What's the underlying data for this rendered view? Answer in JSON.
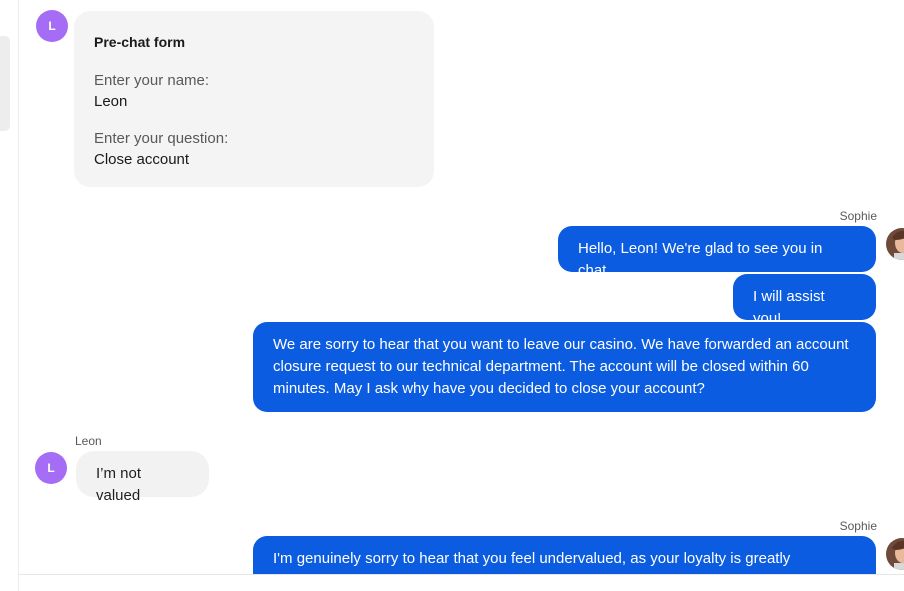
{
  "prechat_form": {
    "avatar_letter": "L",
    "title": "Pre-chat form",
    "fields": [
      {
        "label": "Enter your name:",
        "value": "Leon"
      },
      {
        "label": "Enter your question:",
        "value": "Close account"
      }
    ]
  },
  "messages": [
    {
      "sender": "Sophie",
      "text": "Hello, Leon! We're glad to see you in chat."
    },
    {
      "text": "I will assist you!"
    },
    {
      "text": "We are sorry to hear that you want to leave our casino. We have forwarded an account closure request to our technical department. The account will be closed within 60 minutes. May I ask why have you decided to close your account?"
    },
    {
      "sender": "Leon",
      "avatar_letter": "L",
      "text": "I’m not valued"
    },
    {
      "sender": "Sophie",
      "text": "I'm genuinely sorry to hear that you feel undervalued, as your loyalty is greatly"
    }
  ],
  "colors": {
    "agent_bubble": "#0b5ce0",
    "user_bubble": "#f2f2f2",
    "avatar_user": "#a56cf6"
  },
  "icons": {
    "agent_avatar": "agent-photo-icon"
  }
}
